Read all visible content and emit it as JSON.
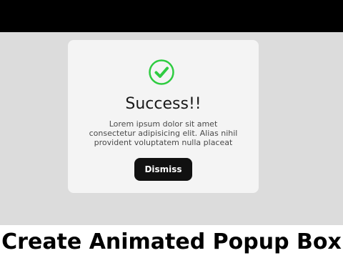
{
  "popup": {
    "icon": "check-circle-icon",
    "title": "Success!!",
    "message": "Lorem ipsum dolor sit amet consectetur adipisicing elit. Alias nihil provident voluptatem nulla placeat",
    "dismiss_label": "Dismiss"
  },
  "caption": "Create Animated Popup Box",
  "colors": {
    "accent_green": "#2ecc40",
    "button": "#111111",
    "popup_bg": "#f4f4f4",
    "page_bg": "#dcdcdc"
  }
}
